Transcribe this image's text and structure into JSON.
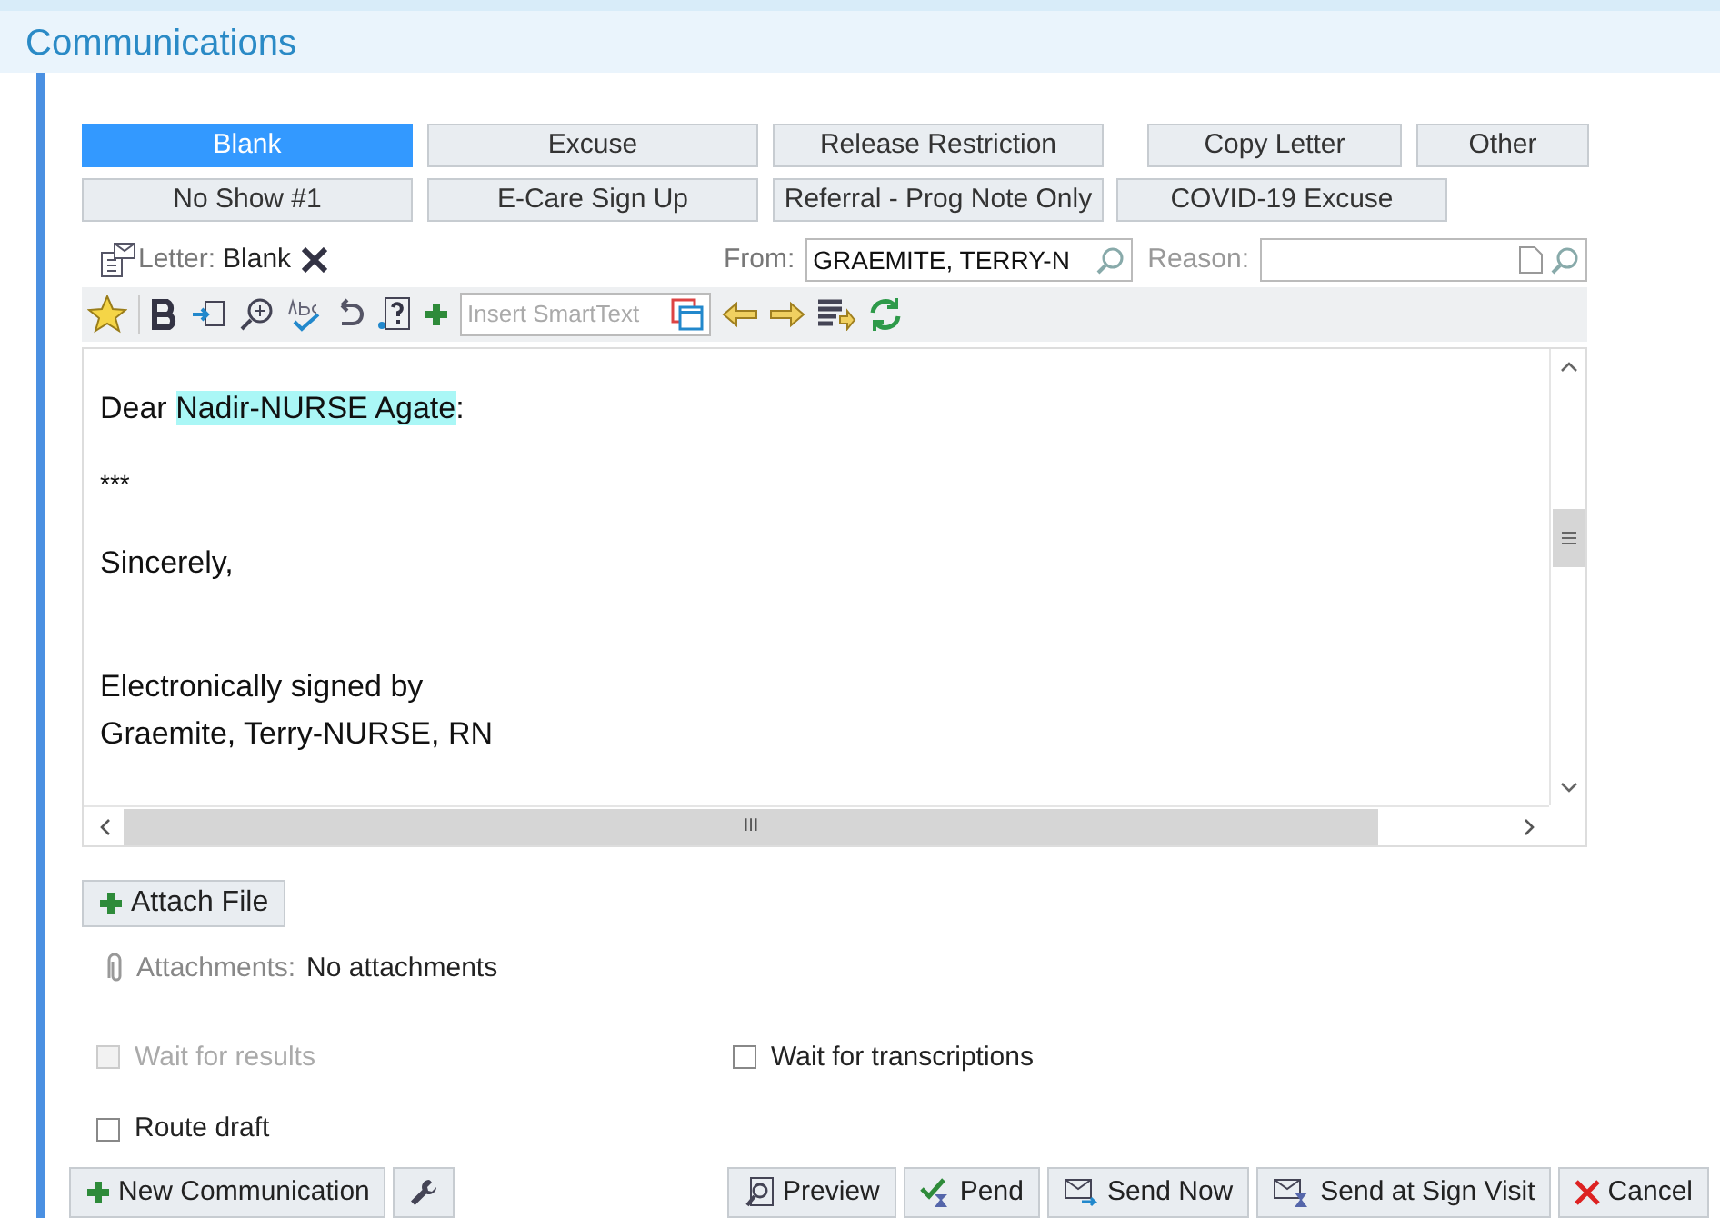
{
  "window": {
    "title": "Communications"
  },
  "templates": [
    [
      {
        "label": "Blank",
        "selected": true
      },
      {
        "label": "Excuse",
        "selected": false
      },
      {
        "label": "Release Restriction",
        "selected": false
      },
      {
        "label": "Copy Letter",
        "selected": false
      },
      {
        "label": "Other",
        "selected": false
      }
    ],
    [
      {
        "label": "No Show #1",
        "selected": false
      },
      {
        "label": "E-Care Sign Up",
        "selected": false
      },
      {
        "label": "Referral - Prog Note Only",
        "selected": false
      },
      {
        "label": "COVID-19 Excuse",
        "selected": false
      }
    ]
  ],
  "letter": {
    "label": "Letter:",
    "value": "Blank"
  },
  "from": {
    "label": "From:",
    "value": "GRAEMITE, TERRY-N"
  },
  "reason": {
    "label": "Reason:"
  },
  "toolbar": {
    "smarttext_placeholder": "Insert SmartText"
  },
  "body": {
    "greeting": {
      "prefix": "Dear ",
      "name": "Nadir-NURSE Agate",
      "suffix": ":"
    },
    "lines": [
      "***",
      "Sincerely,"
    ],
    "signature": [
      "Electronically signed by",
      "Graemite, Terry-NURSE, RN"
    ],
    "scrollbar_glyph": "III"
  },
  "attach_button": "Attach File",
  "attachments": {
    "label": "Attachments:",
    "value": "No attachments"
  },
  "options": [
    {
      "label": "Wait for results",
      "checked": false,
      "disabled": true
    },
    {
      "label": "Wait for transcriptions",
      "checked": false,
      "disabled": false
    },
    {
      "label": "Route draft",
      "checked": false,
      "disabled": false
    }
  ],
  "footer": {
    "left": [
      {
        "label": "New Communication",
        "kind": "new"
      },
      {
        "kind": "tools"
      }
    ],
    "right": [
      {
        "label": "Preview",
        "kind": "preview"
      },
      {
        "label": "Pend",
        "kind": "pend"
      },
      {
        "label": "Send Now",
        "kind": "send"
      },
      {
        "label": "Send at Sign Visit",
        "kind": "sign"
      },
      {
        "label": "Cancel",
        "kind": "cancel"
      }
    ]
  }
}
